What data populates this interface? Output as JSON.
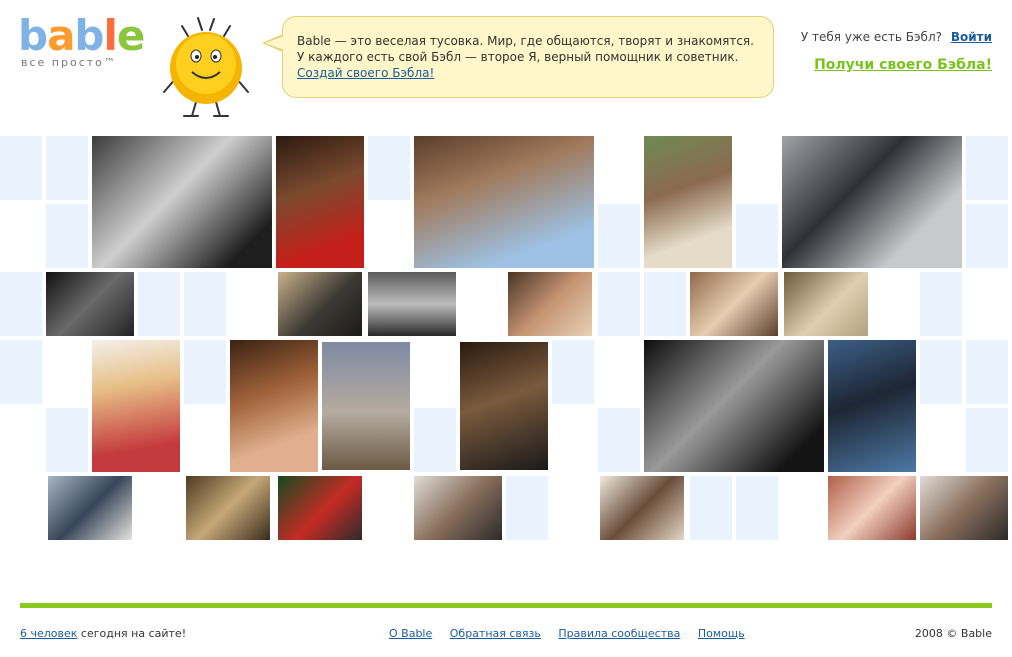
{
  "header": {
    "logo_text": "bable",
    "logo_tagline": "все просто™",
    "bubble_text": "Bable — это веселая тусовка. Мир, где общаются, творят и знакомятся. У каждого есть свой Бэбл — второе Я, верный помощник и советник.",
    "bubble_link": "Создай своего Бэбла!",
    "have_bable": "У тебя уже есть Бэбл?",
    "login": "Войти",
    "get_bable": "Получи своего Бэбла!"
  },
  "mosaic": {
    "blank_color": "#e9f2fd",
    "photo_count": 26
  },
  "footer": {
    "online_link": "6 человек",
    "online_text": " сегодня на сайте!",
    "nav": [
      "О Bable",
      "Обратная связь",
      "Правила сообщества",
      "Помощь"
    ],
    "copyright": "2008 © Bable",
    "bar_color": "#8cc91e"
  },
  "colors": {
    "accent_green": "#7ac21c",
    "link_blue": "#1a5c9e",
    "bubble_bg": "#fff6c9"
  }
}
